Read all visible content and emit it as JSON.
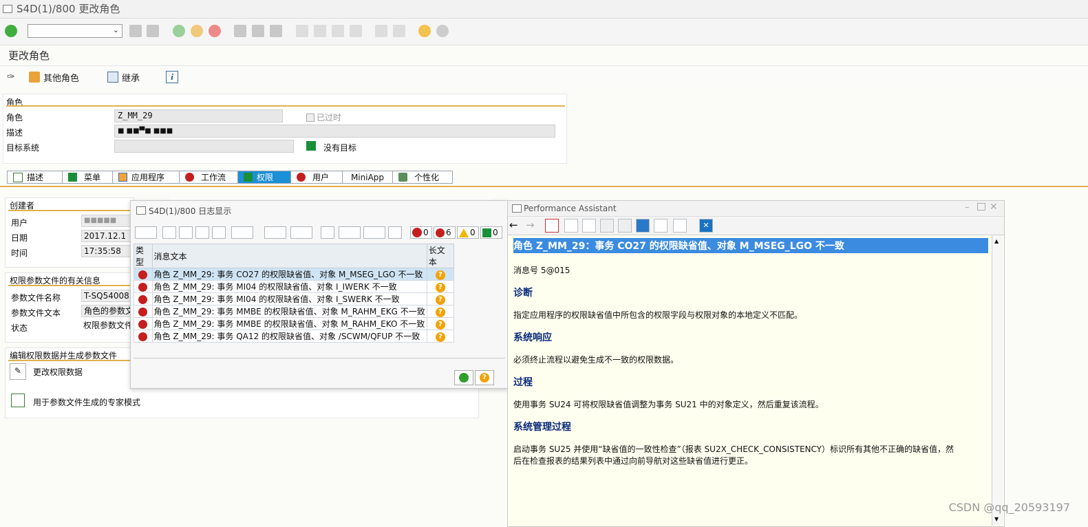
{
  "window": {
    "title": "S4D(1)/800 更改角色"
  },
  "page": {
    "title": "更改角色"
  },
  "app_toolbar": {
    "other_roles": "其他角色",
    "inherit": "继承"
  },
  "role": {
    "section_title": "角色",
    "role_label": "角色",
    "role_value": "Z_MM_29",
    "obsolete_label": "已过时",
    "desc_label": "描述",
    "desc_value": "■ ■■▀■ ■■■",
    "target_label": "目标系统",
    "no_target": "没有目标"
  },
  "tabs": [
    "描述",
    "菜单",
    "应用程序",
    "工作流",
    "权限",
    "用户",
    "MiniApp",
    "个性化"
  ],
  "creator": {
    "section_title": "创建者",
    "user_label": "用户",
    "user_value": "■■■■■",
    "date_label": "日期",
    "date_value": "2017.12.1",
    "time_label": "时间",
    "time_value": "17:35:58"
  },
  "profile": {
    "section_title": "权限参数文件的有关信息",
    "name_label": "参数文件名称",
    "name_value": "T-SQ54008",
    "text_label": "参数文件文本",
    "text_value": "角色的参数文",
    "status_label": "状态",
    "status_value": "权限参数文件"
  },
  "edit": {
    "section_title": "编辑权限数据并生成参数文件",
    "change_btn": "更改权限数据",
    "expert_btn": "用于参数文件生成的专家模式"
  },
  "log_dialog": {
    "title": "S4D(1)/800 日志显示",
    "counts": {
      "stop": "0",
      "error": "6",
      "warning": "0",
      "info": "0"
    },
    "columns": {
      "type": "类型",
      "text": "消息文本",
      "longtext": "长文本"
    },
    "rows": [
      "角色 Z_MM_29: 事务 CO27 的权限缺省值、对象 M_MSEG_LGO 不一致",
      "角色 Z_MM_29: 事务 MI04 的权限缺省值、对象 I_IWERK 不一致",
      "角色 Z_MM_29: 事务 MI04 的权限缺省值、对象 I_SWERK 不一致",
      "角色 Z_MM_29: 事务 MMBE 的权限缺省值、对象 M_RAHM_EKG 不一致",
      "角色 Z_MM_29: 事务 MMBE 的权限缺省值、对象 M_RAHM_EKO 不一致",
      "角色 Z_MM_29: 事务 QA12 的权限缺省值、对象 /SCWM/QFUP 不一致"
    ],
    "q": "?"
  },
  "perf": {
    "title": "Performance Assistant",
    "heading": "角色 Z_MM_29：事务 CO27 的权限缺省值、对象 M_MSEG_LGO 不一致",
    "msgno": "消息号 5@015",
    "h_diag": "诊断",
    "t_diag": "指定应用程序的权限缺省值中所包含的权限字段与权限对象的本地定义不匹配。",
    "h_resp": "系统响应",
    "t_resp": "必须终止流程以避免生成不一致的权限数据。",
    "h_proc": "过程",
    "t_proc": "使用事务 SU24 可将权限缺省值调整为事务 SU21 中的对象定义，然后重复该流程。",
    "h_admin": "系统管理过程",
    "t_admin1": "启动事务 SU25 并使用“缺省值的一致性检查”（报表 SU2X_CHECK_CONSISTENCY）标识所有其他不正确的缺省值，然",
    "t_admin2": "后在检查报表的结果列表中通过向前导航对这些缺省值进行更正。"
  },
  "watermark": "CSDN @qq_20593197"
}
